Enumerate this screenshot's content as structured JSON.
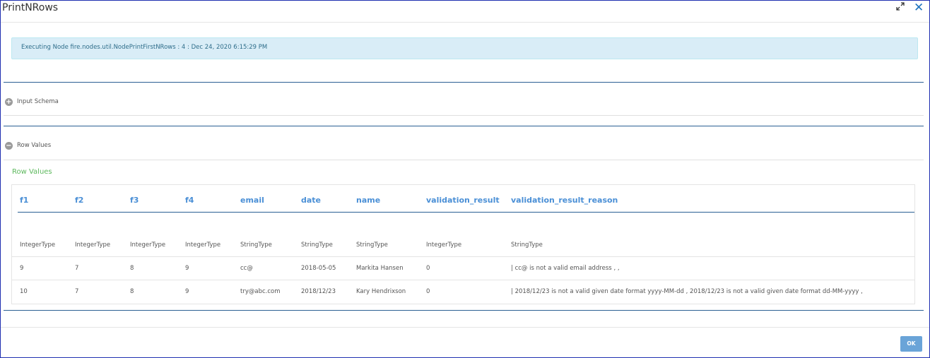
{
  "window": {
    "title": "PrintNRows"
  },
  "banner": {
    "text": "Executing Node fire.nodes.util.NodePrintFirstNRows : 4 : Dec 24, 2020 6:15:29 PM"
  },
  "sections": {
    "input_schema": {
      "label": "Input Schema",
      "expanded": false,
      "icon": "plus-circle-icon"
    },
    "row_values": {
      "label": "Row Values",
      "expanded": true,
      "icon": "minus-circle-icon"
    }
  },
  "row_values_title": "Row Values",
  "table": {
    "columns": [
      "f1",
      "f2",
      "f3",
      "f4",
      "email",
      "date",
      "name",
      "validation_result",
      "validation_result_reason"
    ],
    "types": [
      "IntegerType",
      "IntegerType",
      "IntegerType",
      "IntegerType",
      "StringType",
      "StringType",
      "StringType",
      "IntegerType",
      "StringType"
    ],
    "rows": [
      [
        "9",
        "7",
        "8",
        "9",
        "cc@",
        "2018-05-05",
        "Markita Hansen",
        "0",
        "| cc@ is not a valid email address , ,"
      ],
      [
        "10",
        "7",
        "8",
        "9",
        "try@abc.com",
        "2018/12/23",
        "Kary Hendrixson",
        "0",
        "| 2018/12/23 is not a valid given date format yyyy-MM-dd , 2018/12/23 is not a valid given date format dd-MM-yyyy ,"
      ]
    ]
  },
  "footer": {
    "ok_label": "OK"
  },
  "colors": {
    "accent": "#4a8fd6",
    "banner_bg": "#d9edf7",
    "success_green": "#5cb85c",
    "button": "#6aa4d8"
  }
}
